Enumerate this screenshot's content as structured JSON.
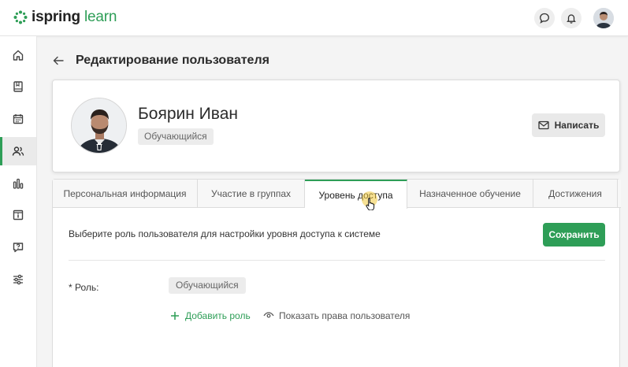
{
  "app": {
    "logo_part1": "ispring",
    "logo_part2": " learn"
  },
  "colors": {
    "accent": "#2e9e57",
    "text": "#333333"
  },
  "topbar": {
    "icons": [
      "chat-icon",
      "bell-icon",
      "user-avatar"
    ]
  },
  "sidebar": {
    "items": [
      {
        "icon": "home-icon"
      },
      {
        "icon": "book-icon"
      },
      {
        "icon": "calendar-icon"
      },
      {
        "icon": "users-icon",
        "active": true
      },
      {
        "icon": "bar-chart-icon"
      },
      {
        "icon": "info-icon"
      },
      {
        "icon": "help-icon"
      },
      {
        "icon": "sliders-icon"
      }
    ]
  },
  "page": {
    "title": "Редактирование пользователя"
  },
  "profile": {
    "name": "Боярин Иван",
    "role_badge": "Обучающийся",
    "write_button": "Написать"
  },
  "tabs": [
    {
      "label": "Персональная информация"
    },
    {
      "label": "Участие в группах"
    },
    {
      "label": "Уровень доступа",
      "active": true
    },
    {
      "label": "Назначенное обучение"
    },
    {
      "label": "Достижения"
    }
  ],
  "access": {
    "hint": "Выберите роль пользователя для настройки уровня доступа к системе",
    "save_button": "Сохранить",
    "role_label": "* Роль:",
    "role_value": "Обучающийся",
    "add_role": "Добавить роль",
    "show_rights": "Показать права пользователя"
  }
}
